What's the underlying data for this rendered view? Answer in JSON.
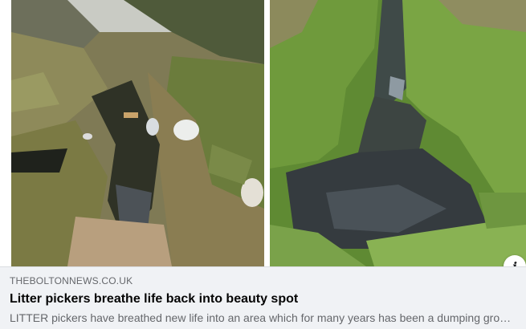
{
  "link_preview": {
    "domain": "THEBOLTONNEWS.CO.UK",
    "headline": "Litter pickers breathe life back into beauty spot",
    "description": "LITTER pickers have breathed new life into an area which for many years has been a dumping ground",
    "info_icon": "i"
  },
  "images": {
    "left": "littered-stream-before-photo",
    "right": "clean-stream-after-photo"
  },
  "icons": {
    "info": "info-icon"
  }
}
